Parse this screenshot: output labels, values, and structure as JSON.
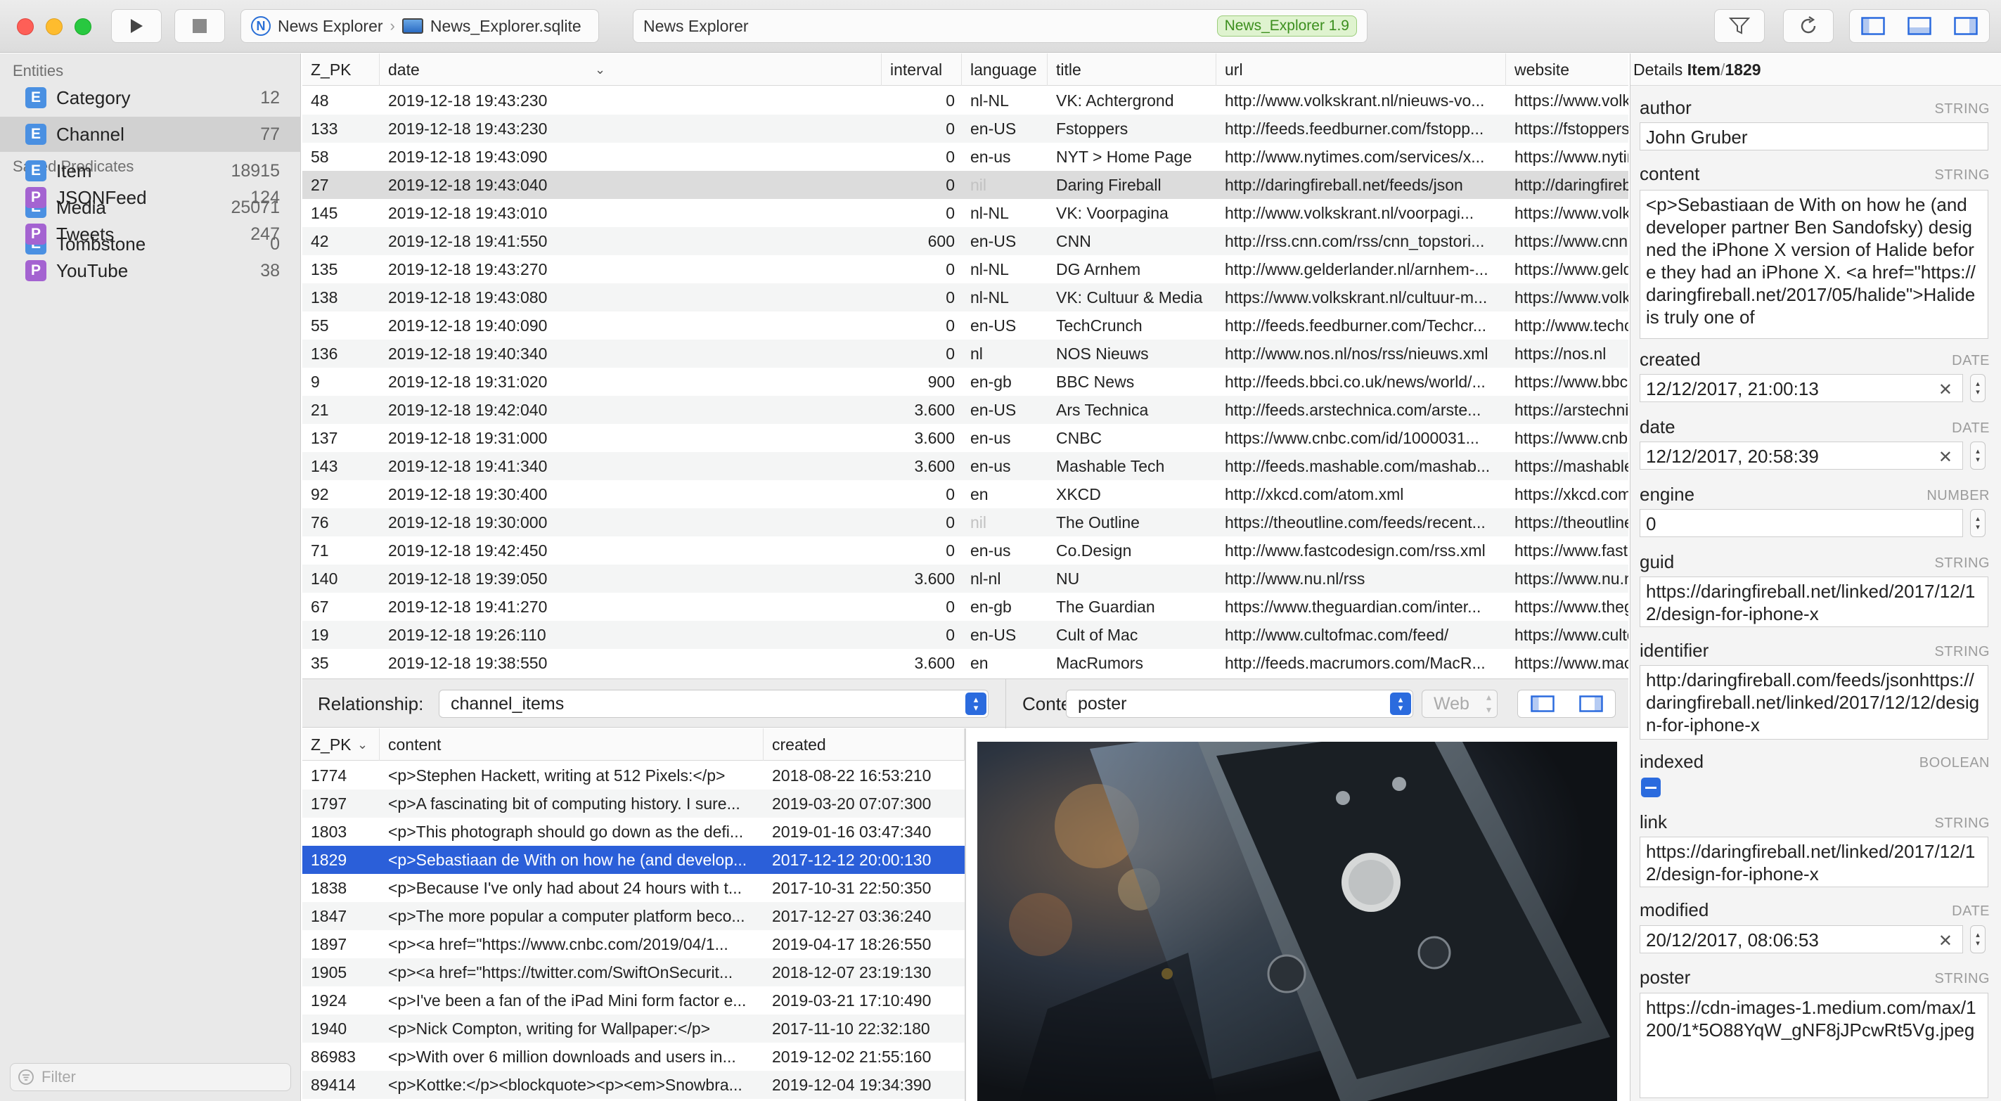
{
  "toolbar": {
    "breadcrumb": [
      "News Explorer",
      "News_Explorer.sqlite"
    ],
    "window_title": "News Explorer",
    "version_badge": "News_Explorer 1.9"
  },
  "sidebar": {
    "entities_header": "Entities",
    "entities": [
      {
        "label": "Category",
        "count": "12",
        "icon": "E"
      },
      {
        "label": "Channel",
        "count": "77",
        "icon": "E"
      },
      {
        "label": "Item",
        "count": "18915",
        "icon": "E"
      },
      {
        "label": "Media",
        "count": "25071",
        "icon": "E"
      },
      {
        "label": "Tombstone",
        "count": "0",
        "icon": "E"
      }
    ],
    "predicates_header": "Saved Predicates",
    "predicates": [
      {
        "label": "JSONFeed",
        "count": "124",
        "icon": "P"
      },
      {
        "label": "Tweets",
        "count": "247",
        "icon": "P"
      },
      {
        "label": "YouTube",
        "count": "38",
        "icon": "P"
      }
    ],
    "filter_placeholder": "Filter"
  },
  "main_table": {
    "columns": [
      "Z_PK",
      "date",
      "interval",
      "language",
      "title",
      "url",
      "website"
    ],
    "rows": [
      [
        "48",
        "2019-12-18 19:43:230",
        "0",
        "nl-NL",
        "VK: Achtergrond",
        "http://www.volkskrant.nl/nieuws-vo...",
        "https://www.volkskrant.nl/nieuws-achtergrond"
      ],
      [
        "133",
        "2019-12-18 19:43:230",
        "0",
        "en-US",
        "Fstoppers",
        "http://feeds.feedburner.com/fstopp...",
        "https://fstoppers.com/"
      ],
      [
        "58",
        "2019-12-18 19:43:090",
        "0",
        "en-us",
        "NYT > Home Page",
        "http://www.nytimes.com/services/x...",
        "https://www.nytimes.com?emc=rss&partner=rss"
      ],
      [
        "27",
        "2019-12-18 19:43:040",
        "0",
        "nil",
        "Daring Fireball",
        "http://daringfireball.net/feeds/json",
        "http://daringfireball.com"
      ],
      [
        "145",
        "2019-12-18 19:43:010",
        "0",
        "nl-NL",
        "VK: Voorpagina",
        "http://www.volkskrant.nl/voorpagi...",
        "https://www.volkskrant.nl/voorpagina"
      ],
      [
        "42",
        "2019-12-18 19:41:550",
        "600",
        "en-US",
        "CNN",
        "http://rss.cnn.com/rss/cnn_topstori...",
        "https://www.cnn.com/index.html"
      ],
      [
        "135",
        "2019-12-18 19:43:270",
        "0",
        "nl-NL",
        "DG Arnhem",
        "http://www.gelderlander.nl/arnhem-...",
        "https://www.gelderlander.nl"
      ],
      [
        "138",
        "2019-12-18 19:43:080",
        "0",
        "nl-NL",
        "VK: Cultuur & Media",
        "https://www.volkskrant.nl/cultuur-m...",
        "https://www.volkskrant.nl/cultuur-media"
      ],
      [
        "55",
        "2019-12-18 19:40:090",
        "0",
        "en-US",
        "TechCrunch",
        "http://feeds.feedburner.com/Techcr...",
        "http://www.techcrunch.com"
      ],
      [
        "136",
        "2019-12-18 19:40:340",
        "0",
        "nl",
        "NOS Nieuws",
        "http://www.nos.nl/nos/rss/nieuws.xml",
        "https://nos.nl"
      ],
      [
        "9",
        "2019-12-18 19:31:020",
        "900",
        "en-gb",
        "BBC News",
        "http://feeds.bbci.co.uk/news/world/...",
        "https://www.bbc.co.uk/news/"
      ],
      [
        "21",
        "2019-12-18 19:42:040",
        "3.600",
        "en-US",
        "Ars Technica",
        "http://feeds.arstechnica.com/arste...",
        "https://arstechnica.com"
      ],
      [
        "137",
        "2019-12-18 19:31:000",
        "3.600",
        "en-us",
        "CNBC",
        "https://www.cnbc.com/id/1000031...",
        "https://www.cnbc.com/us-top-news-and-analysis/"
      ],
      [
        "143",
        "2019-12-18 19:41:340",
        "3.600",
        "en-us",
        "Mashable Tech",
        "http://feeds.mashable.com/mashab...",
        "https://mashable.com/category/tech/?utm_campaign=Ma"
      ],
      [
        "92",
        "2019-12-18 19:30:400",
        "0",
        "en",
        "XKCD",
        "http://xkcd.com/atom.xml",
        "https://xkcd.com/"
      ],
      [
        "76",
        "2019-12-18 19:30:000",
        "0",
        "nil",
        "The Outline",
        "https://theoutline.com/feeds/recent...",
        "https://theoutline.com"
      ],
      [
        "71",
        "2019-12-18 19:42:450",
        "0",
        "en-us",
        "Co.Design",
        "http://www.fastcodesign.com/rss.xml",
        "https://www.fastcompany.com"
      ],
      [
        "140",
        "2019-12-18 19:39:050",
        "3.600",
        "nl-nl",
        "NU",
        "http://www.nu.nl/rss",
        "https://www.nu.nl/"
      ],
      [
        "67",
        "2019-12-18 19:41:270",
        "0",
        "en-gb",
        "The Guardian",
        "https://www.theguardian.com/inter...",
        "https://www.theguardian.com"
      ],
      [
        "19",
        "2019-12-18 19:26:110",
        "0",
        "en-US",
        "Cult of Mac",
        "http://www.cultofmac.com/feed/",
        "https://www.cultofmac.com"
      ],
      [
        "35",
        "2019-12-18 19:38:550",
        "3.600",
        "en",
        "MacRumors",
        "http://feeds.macrumors.com/MacR...",
        "https://www.macrumors.com"
      ]
    ]
  },
  "relationship": {
    "label": "Relationship:",
    "value": "channel_items"
  },
  "content_bar": {
    "label": "Content:",
    "value": "poster",
    "mode": "Web"
  },
  "items_table": {
    "columns": [
      "Z_PK",
      "content",
      "created"
    ],
    "rows": [
      [
        "1774",
        "<p>Stephen Hackett, writing at 512 Pixels:</p>",
        "2018-08-22 16:53:210"
      ],
      [
        "1797",
        "<p>A fascinating bit of computing history. I sure...",
        "2019-03-20 07:07:300"
      ],
      [
        "1803",
        "<p>This photograph should go down as the defi...",
        "2019-01-16 03:47:340"
      ],
      [
        "1829",
        "<p>Sebastiaan de With on how he (and develop...",
        "2017-12-12 20:00:130"
      ],
      [
        "1838",
        "<p>Because I've only had about 24 hours with t...",
        "2017-10-31 22:50:350"
      ],
      [
        "1847",
        "<p>The more popular a computer platform beco...",
        "2017-12-27 03:36:240"
      ],
      [
        "1897",
        "<p><a href=\"https://www.cnbc.com/2019/04/1...",
        "2019-04-17 18:26:550"
      ],
      [
        "1905",
        "<p><a href=\"https://twitter.com/SwiftOnSecurit...",
        "2018-12-07 23:19:130"
      ],
      [
        "1924",
        "<p>I've been a fan of the iPad Mini form factor e...",
        "2019-03-21 17:10:490"
      ],
      [
        "1940",
        "<p>Nick Compton, writing for Wallpaper:</p>",
        "2017-11-10 22:32:180"
      ],
      [
        "86983",
        "<p>With over 6 million downloads and users in...",
        "2019-12-02 21:55:160"
      ],
      [
        "89414",
        "<p>Kottke:</p><blockquote><p><em>Snowbra...",
        "2019-12-04 19:34:390"
      ]
    ]
  },
  "details": {
    "header_prefix": "Details",
    "header_entity": "Item",
    "header_sep": "/",
    "header_id": "1829",
    "fields": {
      "author": {
        "label": "author",
        "type": "STRING",
        "value": "John Gruber"
      },
      "content": {
        "label": "content",
        "type": "STRING",
        "value": "<p>Sebastiaan de With on how he (and developer partner Ben Sandofsky) designed the iPhone X version of Halide before they had an iPhone X. <a href=\"https://daringfireball.net/2017/05/halide\">Halide is truly one of"
      },
      "created": {
        "label": "created",
        "type": "DATE",
        "value": "12/12/2017, 21:00:13"
      },
      "date": {
        "label": "date",
        "type": "DATE",
        "value": "12/12/2017, 20:58:39"
      },
      "engine": {
        "label": "engine",
        "type": "NUMBER",
        "value": "0"
      },
      "guid": {
        "label": "guid",
        "type": "STRING",
        "value": "https://daringfireball.net/linked/2017/12/12/design-for-iphone-x"
      },
      "identifier": {
        "label": "identifier",
        "type": "STRING",
        "value": "http:/daringfireball.com/feeds/jsonhttps://daringfireball.net/linked/2017/12/12/design-for-iphone-x"
      },
      "indexed": {
        "label": "indexed",
        "type": "BOOLEAN"
      },
      "link": {
        "label": "link",
        "type": "STRING",
        "value": "https://daringfireball.net/linked/2017/12/12/design-for-iphone-x"
      },
      "modified": {
        "label": "modified",
        "type": "DATE",
        "value": "20/12/2017, 08:06:53"
      },
      "poster": {
        "label": "poster",
        "type": "STRING",
        "value": "https://cdn-images-1.medium.com/max/1200/1*5O88YqW_gNF8jJPcwRt5Vg.jpeg"
      }
    }
  },
  "colors": {
    "selection": "#2b5fd9",
    "entity_icon": "#4a90e2",
    "predicate_icon": "#a463d1",
    "badge_text": "#3c8f1e"
  }
}
